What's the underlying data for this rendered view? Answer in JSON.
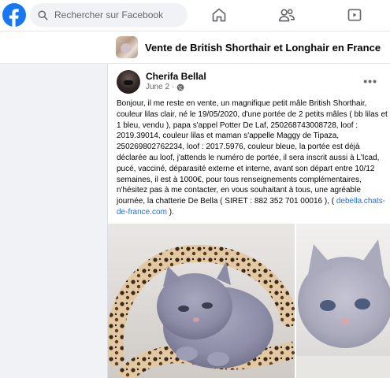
{
  "topbar": {
    "search_placeholder": "Rechercher sur Facebook",
    "nav_icons": [
      "home-icon",
      "friends-icon",
      "watch-icon"
    ],
    "brand_color": "#1877f2"
  },
  "group": {
    "title": "Vente de British Shorthair et Longhair en France"
  },
  "post": {
    "author": "Cherifa Bellal",
    "date": "June 2",
    "separator": "·",
    "privacy_icon": "globe-icon",
    "more_label": "•••",
    "text_before_link": "Bonjour, il me reste en vente, un magnifique petit mâle British Shorthair, couleur lilas clair, né le 19/05/2020, d'une portée de 2 petits mâles ( bb lilas et 1 bleu, vendu ), papa s'appel Potter De Laf, 250268743008728, loof : 2019.39014, couleur lilas et maman s'appelle Maggy de Tipaza, 250269802762234, loof : 2017.5976, couleur bleue, la portée est déjà déclarée au loof, j'attends le numéro de portée, il sera inscrit aussi à L'Icad, pucé, vacciné, déparasité externe et interne, avant son départ entre 10/12 semaines, il est à 1000€, pour tous renseignements complémentaires, n'hésitez pas à me contacter, en vous souhaitant à tous, une agréable journée, la chatterie De Bella ( SIRET : 882 352 701 00016 ), ( ",
    "link_text": "debella.chats-de-france.com",
    "text_after_link": " ).",
    "link_color": "#216fdb"
  }
}
